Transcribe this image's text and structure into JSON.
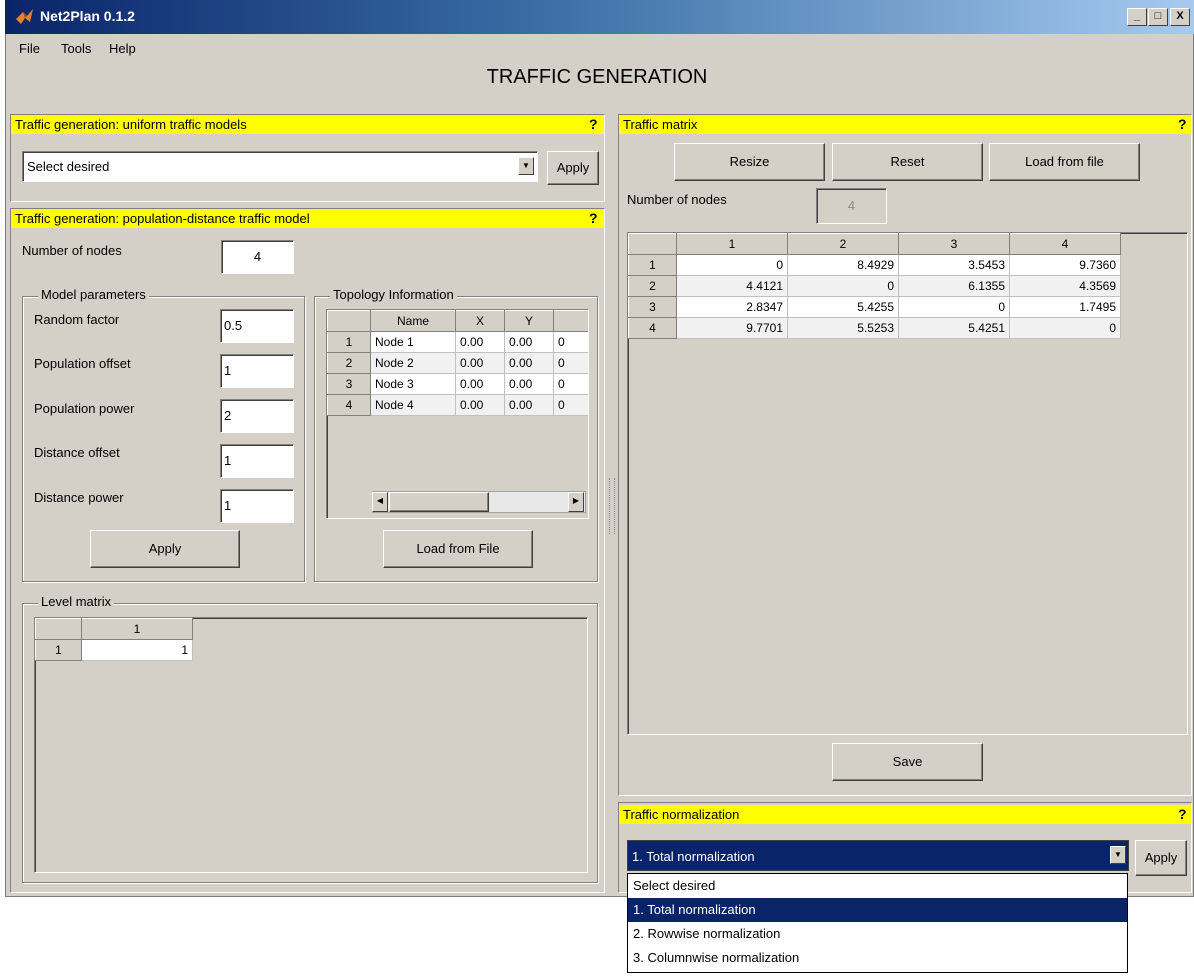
{
  "window": {
    "title": "Net2Plan 0.1.2",
    "controls": [
      "_",
      "□",
      "X"
    ]
  },
  "menu": {
    "file": "File",
    "tools": "Tools",
    "help": "Help"
  },
  "page_title": "TRAFFIC GENERATION",
  "uniform": {
    "header": "Traffic generation: uniform traffic models",
    "help": "?",
    "select_value": "Select desired",
    "apply": "Apply"
  },
  "popdist": {
    "header": "Traffic generation: population-distance traffic model",
    "help": "?",
    "num_nodes_label": "Number of nodes",
    "num_nodes_value": "4",
    "model_params": {
      "title": "Model parameters",
      "random_factor_label": "Random factor",
      "random_factor": "0.5",
      "pop_offset_label": "Population offset",
      "pop_offset": "1",
      "pop_power_label": "Population power",
      "pop_power": "2",
      "dist_offset_label": "Distance offset",
      "dist_offset": "1",
      "dist_power_label": "Distance power",
      "dist_power": "1",
      "apply": "Apply"
    },
    "topology": {
      "title": "Topology Information",
      "columns": [
        "Name",
        "X",
        "Y"
      ],
      "rows": [
        {
          "idx": "1",
          "name": "Node 1",
          "x": "0.00",
          "y": "0.00",
          "extra": "0"
        },
        {
          "idx": "2",
          "name": "Node 2",
          "x": "0.00",
          "y": "0.00",
          "extra": "0"
        },
        {
          "idx": "3",
          "name": "Node 3",
          "x": "0.00",
          "y": "0.00",
          "extra": "0"
        },
        {
          "idx": "4",
          "name": "Node 4",
          "x": "0.00",
          "y": "0.00",
          "extra": "0"
        }
      ],
      "load": "Load from File"
    },
    "level": {
      "title": "Level matrix",
      "col": "1",
      "row_idx": "1",
      "value": "1"
    }
  },
  "matrix": {
    "header": "Traffic matrix",
    "help": "?",
    "resize": "Resize",
    "reset": "Reset",
    "load": "Load from file",
    "num_nodes_label": "Number of nodes",
    "num_nodes_value": "4",
    "columns": [
      "1",
      "2",
      "3",
      "4"
    ],
    "rows": [
      {
        "idx": "1",
        "cells": [
          "0",
          "8.4929",
          "3.5453",
          "9.7360"
        ]
      },
      {
        "idx": "2",
        "cells": [
          "4.4121",
          "0",
          "6.1355",
          "4.3569"
        ]
      },
      {
        "idx": "3",
        "cells": [
          "2.8347",
          "5.4255",
          "0",
          "1.7495"
        ]
      },
      {
        "idx": "4",
        "cells": [
          "9.7701",
          "5.5253",
          "5.4251",
          "0"
        ]
      }
    ],
    "save": "Save"
  },
  "normalization": {
    "header": "Traffic normalization",
    "help": "?",
    "selected": "1. Total normalization",
    "apply": "Apply",
    "options": [
      "Select desired",
      "1. Total normalization",
      "2. Rowwise normalization",
      "3. Columnwise normalization"
    ]
  },
  "colors": {
    "header_yellow": "#ffff00",
    "title_blue": "#0a246a",
    "selection": "#0a246a",
    "face": "#d4d0c8"
  }
}
